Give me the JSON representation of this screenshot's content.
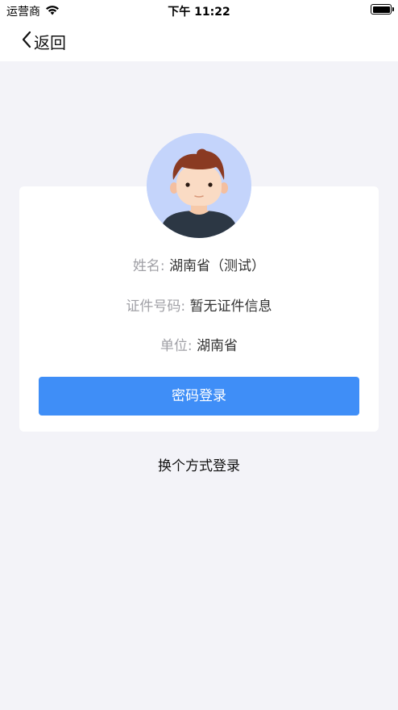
{
  "status_bar": {
    "carrier": "运营商",
    "time": "下午 11:22",
    "wifi_icon": "wifi-icon",
    "battery_icon": "battery-icon"
  },
  "nav": {
    "back_label": "返回",
    "back_icon": "chevron-left-icon"
  },
  "profile": {
    "avatar_icon": "user-avatar",
    "name_label": "姓名:",
    "name_value": "湖南省（测试）",
    "id_label": "证件号码:",
    "id_value": "暂无证件信息",
    "unit_label": "单位:",
    "unit_value": "湖南省"
  },
  "actions": {
    "password_login": "密码登录",
    "switch_login": "换个方式登录"
  },
  "colors": {
    "primary": "#3f8ef7",
    "background": "#f3f3f8",
    "avatar_bg": "#c4d4fb"
  }
}
